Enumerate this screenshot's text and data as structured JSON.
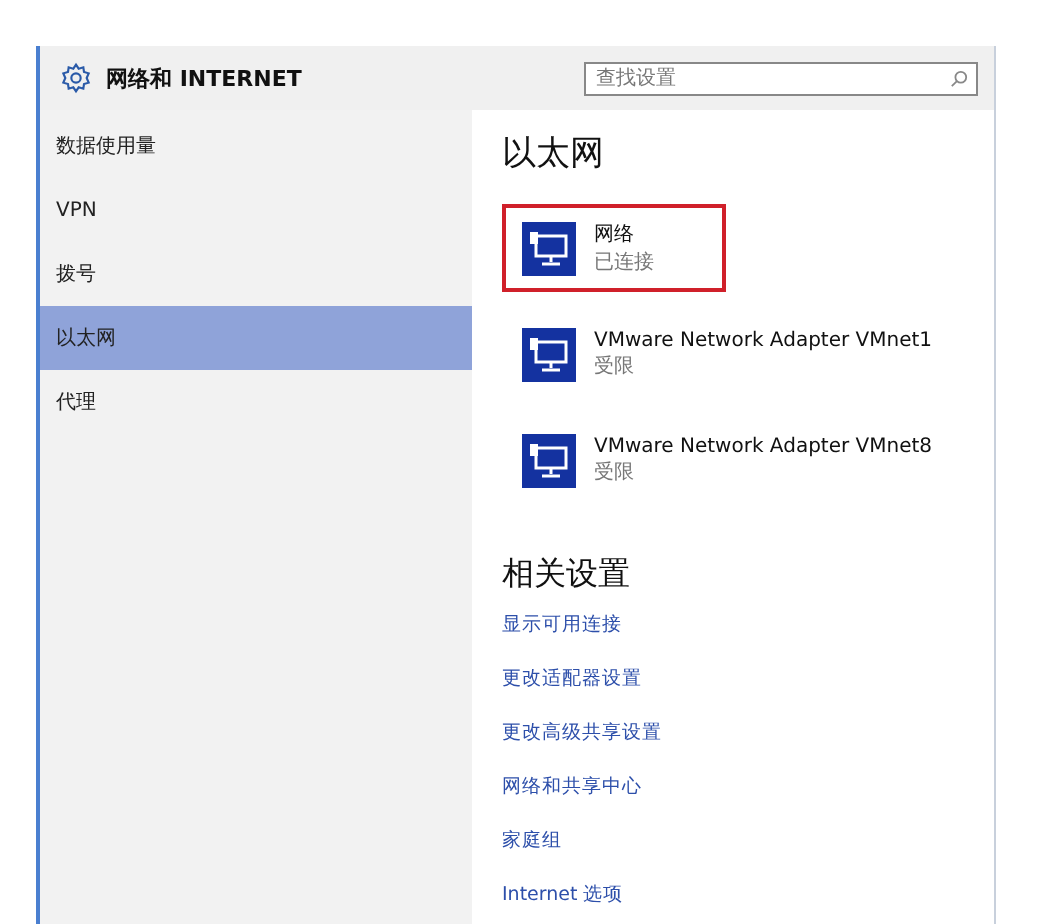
{
  "window": {
    "title": "网络和 INTERNET"
  },
  "search": {
    "placeholder": "查找设置"
  },
  "sidebar": {
    "items": [
      {
        "label": "数据使用量",
        "selected": false
      },
      {
        "label": "VPN",
        "selected": false
      },
      {
        "label": "拨号",
        "selected": false
      },
      {
        "label": "以太网",
        "selected": true
      },
      {
        "label": "代理",
        "selected": false
      }
    ]
  },
  "content": {
    "title": "以太网",
    "networks": [
      {
        "name": "网络",
        "status": "已连接",
        "selected": true
      },
      {
        "name": "VMware Network Adapter VMnet1",
        "status": "受限",
        "selected": false
      },
      {
        "name": "VMware Network Adapter VMnet8",
        "status": "受限",
        "selected": false
      }
    ],
    "related_title": "相关设置",
    "links": [
      "显示可用连接",
      "更改适配器设置",
      "更改高级共享设置",
      "网络和共享中心",
      "家庭组",
      "Internet 选项"
    ]
  }
}
